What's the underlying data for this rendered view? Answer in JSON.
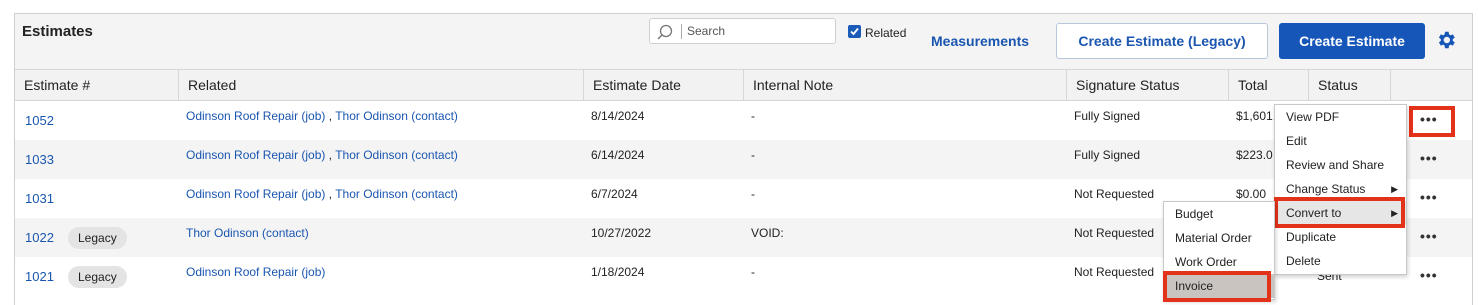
{
  "toolbar": {
    "title": "Estimates",
    "search_placeholder": "Search",
    "related_label": "Related",
    "measurements_label": "Measurements",
    "create_legacy_label": "Create Estimate (Legacy)",
    "create_label": "Create Estimate"
  },
  "columns": [
    "Estimate #",
    "Related",
    "Estimate Date",
    "Internal Note",
    "Signature Status",
    "Total",
    "Status"
  ],
  "rows": [
    {
      "number": "1052",
      "badge": "",
      "related_job": "Odinson Roof Repair (job)",
      "related_sep": " , ",
      "related_contact": "Thor Odinson (contact)",
      "date": "8/14/2024",
      "note": "-",
      "signature": "Fully Signed",
      "total": "$1,601.",
      "status": ""
    },
    {
      "number": "1033",
      "badge": "",
      "related_job": "Odinson Roof Repair (job)",
      "related_sep": " , ",
      "related_contact": "Thor Odinson (contact)",
      "date": "6/14/2024",
      "note": "-",
      "signature": "Fully Signed",
      "total": "$223.0",
      "status": ""
    },
    {
      "number": "1031",
      "badge": "",
      "related_job": "Odinson Roof Repair (job)",
      "related_sep": " , ",
      "related_contact": "Thor Odinson (contact)",
      "date": "6/7/2024",
      "note": "-",
      "signature": "Not Requested",
      "total": "$0.00",
      "status": ""
    },
    {
      "number": "1022",
      "badge": "Legacy",
      "related_job": "",
      "related_sep": "",
      "related_contact": "Thor Odinson (contact)",
      "date": "10/27/2022",
      "note": "VOID:",
      "signature": "Not Requested",
      "total": "",
      "status": ""
    },
    {
      "number": "1021",
      "badge": "Legacy",
      "related_job": "Odinson Roof Repair (job)",
      "related_sep": "",
      "related_contact": "",
      "date": "1/18/2024",
      "note": "-",
      "signature": "Not Requested",
      "total": "",
      "status": "Sent"
    }
  ],
  "row_action_icon": "more-dots-icon",
  "row_action_glyph": "•••",
  "context_menu": [
    {
      "label": "View PDF",
      "has_submenu": false
    },
    {
      "label": "Edit",
      "has_submenu": false
    },
    {
      "label": "Review and Share",
      "has_submenu": false
    },
    {
      "label": "Change Status",
      "has_submenu": true
    },
    {
      "label": "Convert to",
      "has_submenu": true
    },
    {
      "label": "Duplicate",
      "has_submenu": false
    },
    {
      "label": "Delete",
      "has_submenu": false
    }
  ],
  "convert_submenu": [
    "Budget",
    "Material Order",
    "Work Order",
    "Invoice"
  ],
  "submenu_arrow": "▶",
  "colors": {
    "accent": "#1556b8",
    "link": "#1a56b0",
    "highlight": "#e3321a"
  }
}
